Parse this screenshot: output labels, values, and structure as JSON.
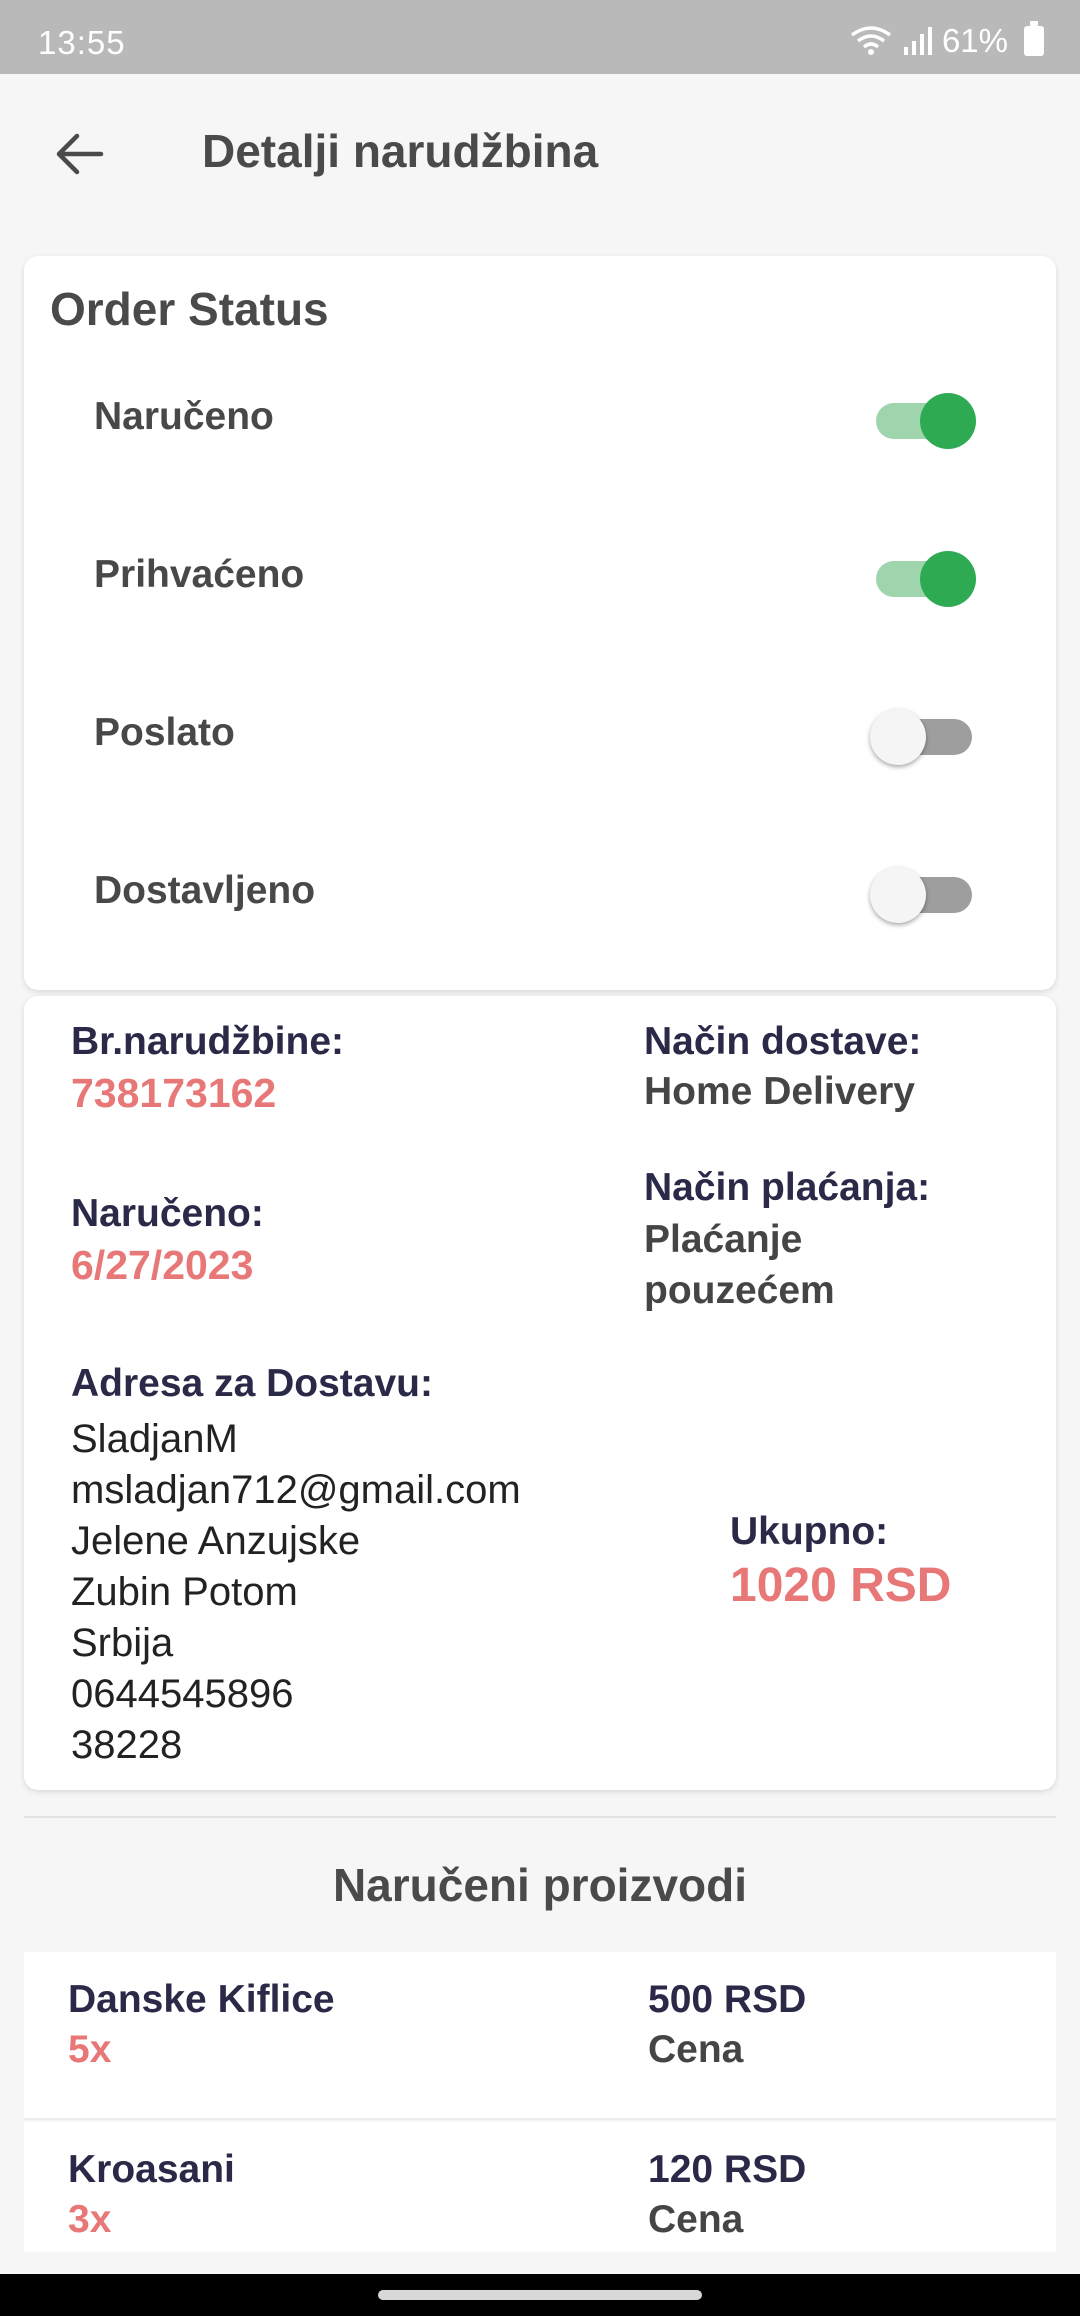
{
  "status_bar": {
    "time": "13:55",
    "battery": "61%"
  },
  "app_bar": {
    "title": "Detalji narudžbina"
  },
  "order_status": {
    "heading": "Order Status",
    "items": [
      {
        "label": "Naručeno",
        "on": true
      },
      {
        "label": "Prihvaćeno",
        "on": true
      },
      {
        "label": "Poslato",
        "on": false
      },
      {
        "label": "Dostavljeno",
        "on": false
      }
    ]
  },
  "details": {
    "order_number_label": "Br.narudžbine:",
    "order_number": "738173162",
    "delivery_method_label": "Način dostave:",
    "delivery_method": "Home Delivery",
    "ordered_label": "Naručeno:",
    "ordered_date": "6/27/2023",
    "payment_method_label": "Način plaćanja:",
    "payment_method": "Plaćanje pouzećem",
    "address_label": "Adresa za Dostavu:",
    "address_lines": [
      "SladjanM",
      "msladjan712@gmail.com",
      "Jelene Anzujske",
      "Zubin Potom",
      "Srbija",
      "0644545896",
      "38228"
    ],
    "total_label": "Ukupno:",
    "total_value": "1020 RSD"
  },
  "products": {
    "title": "Naručeni proizvodi",
    "items": [
      {
        "name": "Danske Kiflice",
        "qty": "5x",
        "price": "500 RSD",
        "price_label": "Cena"
      },
      {
        "name": "Kroasani",
        "qty": "3x",
        "price": "120 RSD",
        "price_label": "Cena"
      }
    ]
  },
  "colors": {
    "accent_red": "#e87777",
    "toggle_on": "#2eaa52",
    "toggle_track_on": "#9ed5ad",
    "label_dark": "#2a2a48"
  }
}
